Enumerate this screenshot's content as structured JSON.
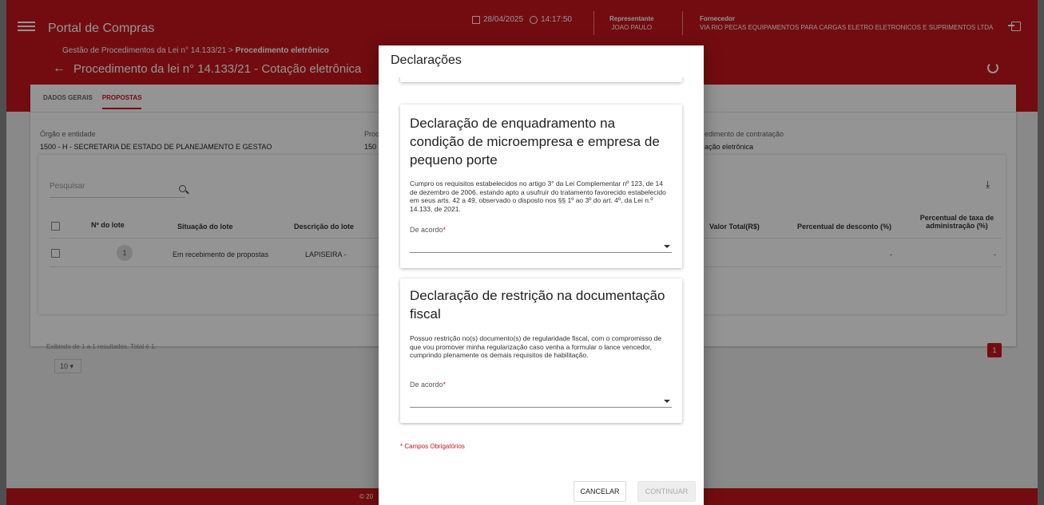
{
  "app": {
    "title": "Portal de Compras",
    "date": "28/04/2025",
    "time": "14:17:50",
    "representative_label": "Representante",
    "representative_name": "JOAO PAULO",
    "supplier_label": "Fornecedor",
    "supplier_name": "VIA RIO PECAS EQUIPAMENTOS PARA CARGAS ELETRO ELETRONICOS E SUPRIMENTOS LTDA",
    "breadcrumb_prefix": "Gestão de Procedimentos da Lei n° 14.133/21 > ",
    "breadcrumb_current": "Procedimento eletrônico",
    "page_title": "Procedimento da lei n° 14.133/21 - Cotação eletrônica",
    "brand_color": "#c7161c"
  },
  "tabs": [
    {
      "label": "DADOS GERAIS"
    },
    {
      "label": "PROPOSTAS"
    }
  ],
  "info": {
    "org_label": "Órgão e entidade",
    "org_value": "1500 - H - SECRETARIA DE ESTADO DE PLANEJAMENTO E GESTAO",
    "proc_label": "Proc",
    "proc_value": "150",
    "mode_label": "edimento de contratação",
    "mode_value": "ação eletrônica"
  },
  "table": {
    "search_placeholder": "Pesquisar",
    "headers": {
      "lot": "Nº do lote",
      "status": "Situação do lote",
      "description": "Descrição do lote",
      "total": "Valor Total(R$)",
      "discount": "Percentual de desconto (%)",
      "admin_fee": "Percentual de taxa de administração (%)"
    },
    "row": {
      "lot": "1",
      "status": "Em recebimento de propostas",
      "description": "LAPISEIRA -",
      "discount": "-",
      "admin_fee": "-"
    },
    "results_text": "Exibindo de 1 a 1 resultados. Total é 1.",
    "per_page": "10",
    "current_page": "1"
  },
  "modal": {
    "title": "Declarações",
    "declarations": [
      {
        "title": "Declaração de enquadramento na condição de microempresa e empresa de pequeno porte",
        "body": "Cumpro os requisitos estabelecidos no artigo 3° da Lei Complementar nº 123, de 14 de dezembro de 2006, estando apto a usufruir do tratamento favorecido estabelecido em seus arts. 42 a 49, observado o disposto nos §§ 1º ao 3º do art. 4º, da Lei n.º 14.133, de 2021.",
        "select_label": "De acordo",
        "select_value": ""
      },
      {
        "title": "Declaração de restrição na documentação fiscal",
        "body": "Possuo restrição no(s) documento(s) de regularidade fiscal, com o compromisso de que vou promover minha regularização caso venha a formular o lance vencedor, cumprindo plenamente os demais requisitos de habilitação.",
        "select_label": "De acordo",
        "select_value": ""
      }
    ],
    "required_note": "* Campos Obrigatórios",
    "cancel_label": "CANCELAR",
    "continue_label": "CONTINUAR"
  },
  "footer": {
    "text": "© 20"
  }
}
